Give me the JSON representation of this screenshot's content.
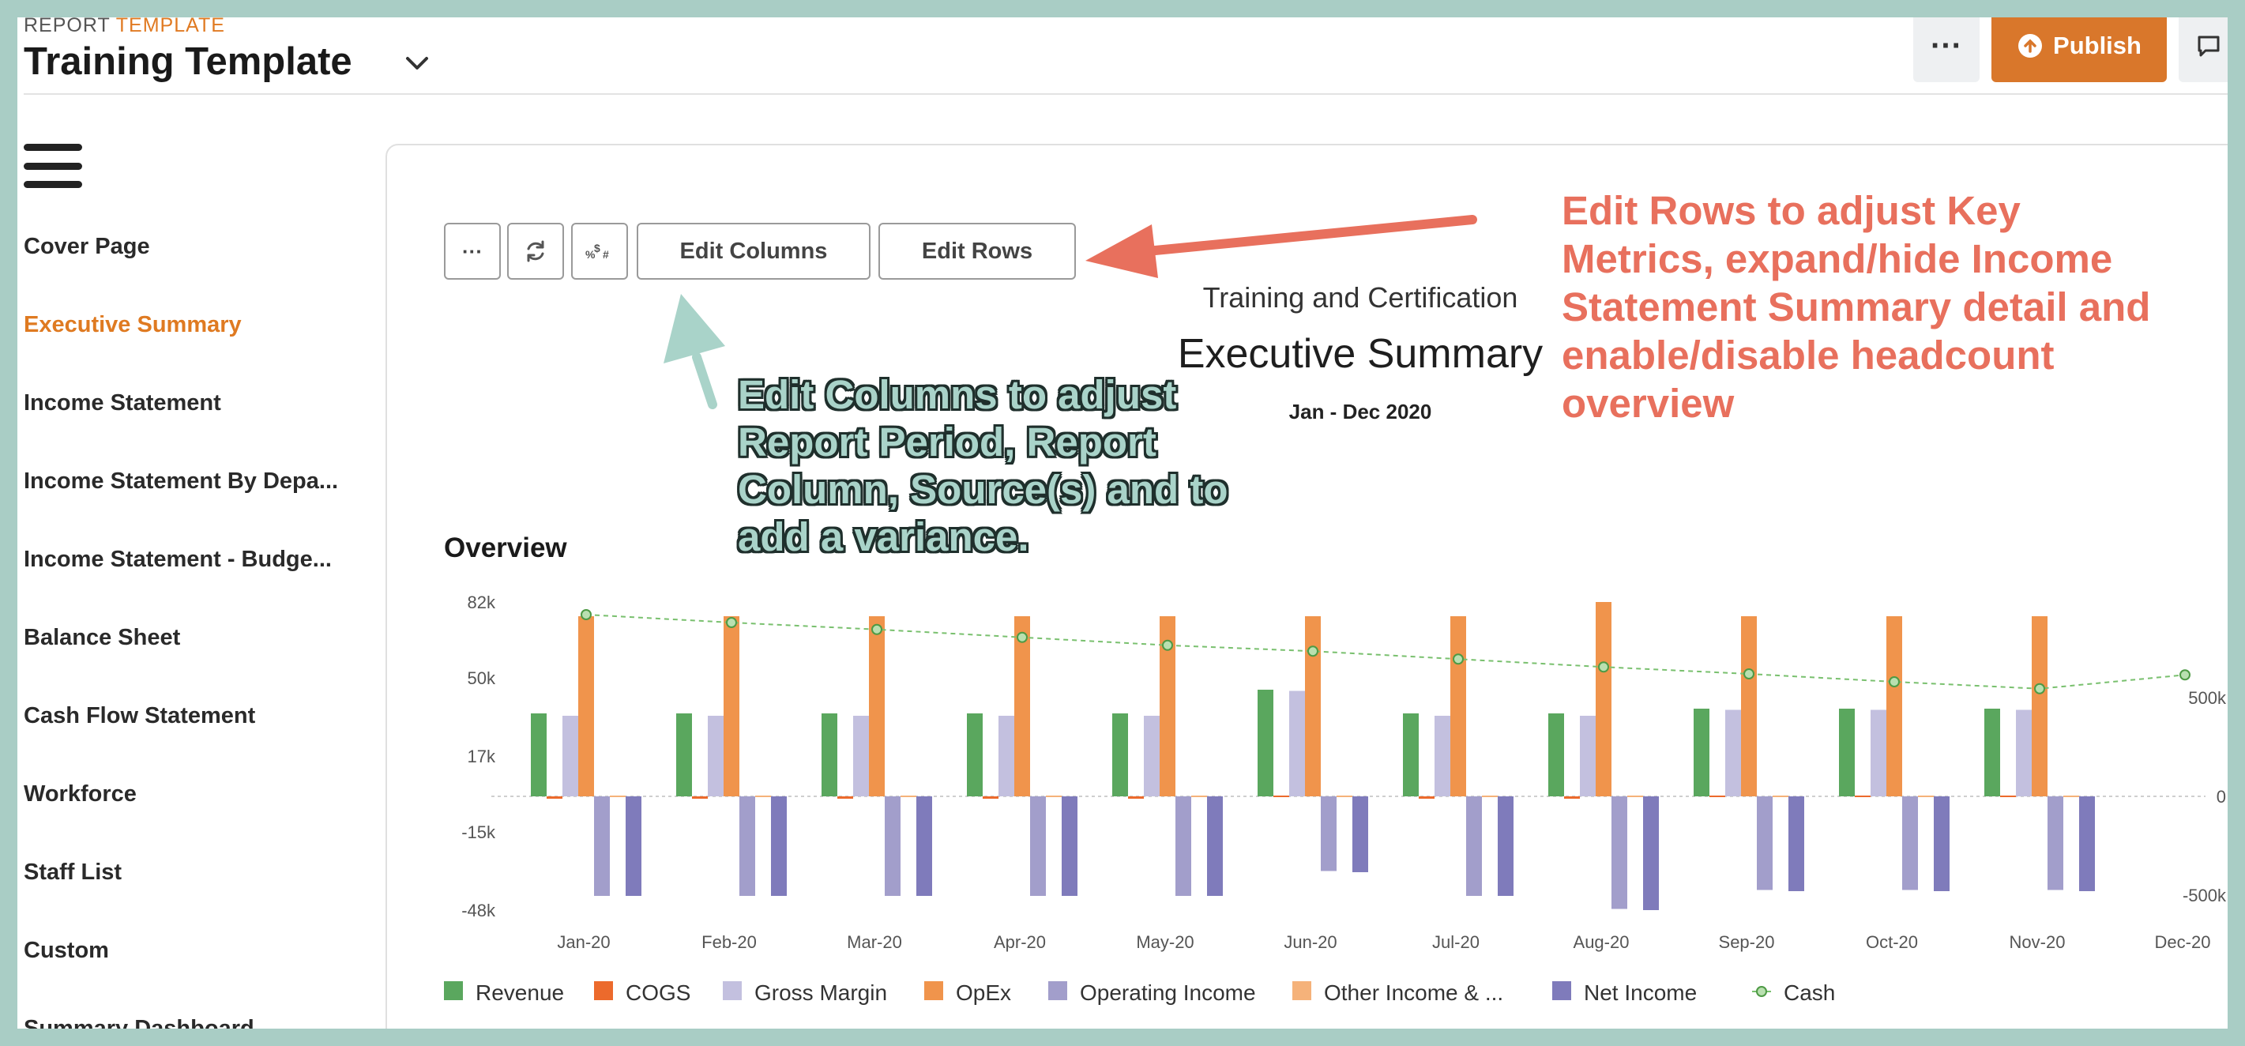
{
  "header": {
    "kind_prefix": "REPORT",
    "kind_accent": "TEMPLATE",
    "title": "Training Template",
    "more_label": "···",
    "publish_label": "Publish"
  },
  "sidebar": {
    "items": [
      {
        "label": "Cover Page"
      },
      {
        "label": "Executive Summary"
      },
      {
        "label": "Income Statement"
      },
      {
        "label": "Income Statement By Depa..."
      },
      {
        "label": "Income Statement - Budge..."
      },
      {
        "label": "Balance Sheet"
      },
      {
        "label": "Cash Flow Statement"
      },
      {
        "label": "Workforce"
      },
      {
        "label": "Staff List"
      },
      {
        "label": "Custom"
      },
      {
        "label": "Summary Dashboard"
      }
    ],
    "active_index": 1
  },
  "toolbar": {
    "more_label": "···",
    "edit_columns_label": "Edit Columns",
    "edit_rows_label": "Edit Rows"
  },
  "report": {
    "company": "Training and Certification",
    "title": "Executive Summary",
    "period": "Jan - Dec 2020",
    "overview_label": "Overview"
  },
  "annotations": {
    "edit_rows": "Edit Rows to adjust Key Metrics, expand/hide Income Statement Summary detail and enable/disable headcount overview",
    "edit_columns": "Edit Columns to adjust Report Period, Report Column, Source(s) and to add a variance."
  },
  "colors": {
    "accent": "#df7a21",
    "annotation_red": "#e8705d",
    "annotation_teal": "#a9d3c9",
    "revenue": "#5aa75e",
    "cogs": "#ec6a2c",
    "gross_margin": "#c3c0df",
    "opex": "#f0944c",
    "operating_income": "#a29ecb",
    "other_income": "#f5b27a",
    "net_income": "#7f7bbb",
    "cash": "#79c06e"
  },
  "chart_data": {
    "type": "bar",
    "categories": [
      "Jan-20",
      "Feb-20",
      "Mar-20",
      "Apr-20",
      "May-20",
      "Jun-20",
      "Jul-20",
      "Aug-20",
      "Sep-20",
      "Oct-20",
      "Nov-20",
      "Dec-20"
    ],
    "y_left_ticks": [
      "82k",
      "50k",
      "17k",
      "-15k",
      "-48k"
    ],
    "y_left_tick_values": [
      82000,
      50000,
      17000,
      -15000,
      -48000
    ],
    "y_right_ticks": [
      "500k",
      "0",
      "-500k"
    ],
    "y_right_tick_values": [
      500000,
      0,
      -500000
    ],
    "ylim": [
      -48000,
      82000
    ],
    "y2lim": [
      -500000,
      500000
    ],
    "series": [
      {
        "name": "Revenue",
        "color_key": "revenue",
        "values": [
          35000,
          35000,
          35000,
          35000,
          35000,
          45000,
          35000,
          35000,
          37000,
          37000,
          37000,
          null
        ]
      },
      {
        "name": "COGS",
        "color_key": "cogs",
        "values": [
          -1000,
          -1000,
          -1000,
          -1000,
          -1000,
          -500,
          -1000,
          -1000,
          -500,
          -500,
          -500,
          null
        ]
      },
      {
        "name": "Gross Margin",
        "color_key": "gross_margin",
        "values": [
          34000,
          34000,
          34000,
          34000,
          34000,
          44500,
          34000,
          34000,
          36500,
          36500,
          36500,
          null
        ]
      },
      {
        "name": "OpEx",
        "color_key": "opex",
        "values": [
          76000,
          76000,
          76000,
          76000,
          76000,
          76000,
          76000,
          82000,
          76000,
          76000,
          76000,
          null
        ]
      },
      {
        "name": "Operating Income",
        "color_key": "operating_income",
        "values": [
          -42000,
          -42000,
          -42000,
          -42000,
          -42000,
          -31500,
          -42000,
          -47500,
          -39500,
          -39500,
          -39500,
          null
        ]
      },
      {
        "name": "Other Income & ...",
        "color_key": "other_income",
        "values": [
          0,
          0,
          0,
          0,
          0,
          0,
          0,
          0,
          0,
          0,
          0,
          null
        ]
      },
      {
        "name": "Net Income",
        "color_key": "net_income",
        "values": [
          -42000,
          -42000,
          -42000,
          -42000,
          -42000,
          -32000,
          -42000,
          -48000,
          -40000,
          -40000,
          -40000,
          null
        ]
      },
      {
        "name": "Cash",
        "color_key": "cash",
        "type": "line",
        "axis": "right",
        "values": [
          920000,
          880000,
          845000,
          805000,
          765000,
          735000,
          695000,
          655000,
          620000,
          580000,
          545000,
          615000
        ]
      }
    ],
    "legend_position": "bottom"
  }
}
